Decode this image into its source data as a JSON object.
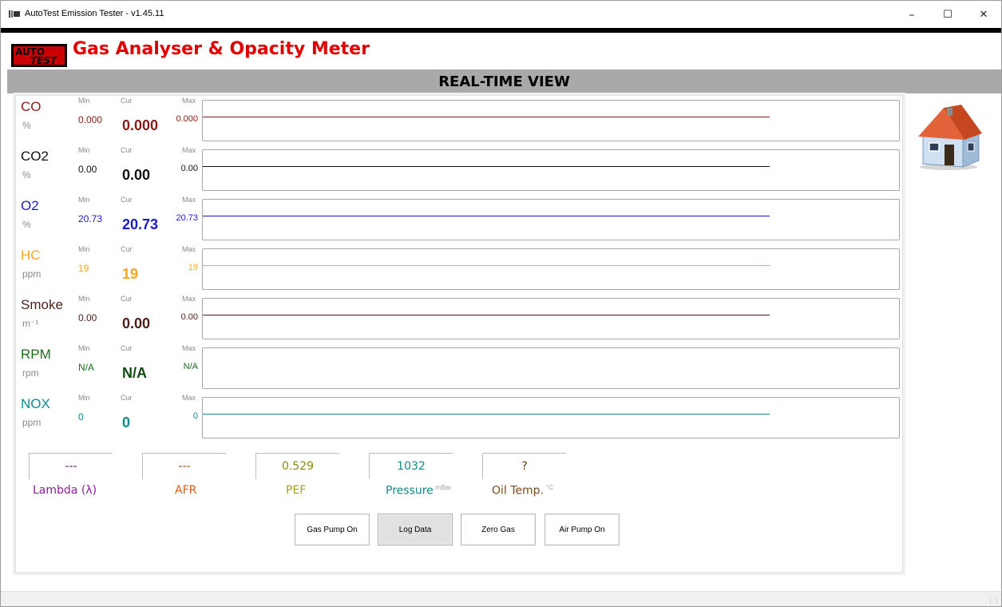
{
  "window": {
    "title": "AutoTest Emission Tester - v1.45.11",
    "minimize_glyph": "–",
    "maximize_glyph": "☐",
    "close_glyph": "✕"
  },
  "header": {
    "logo_top": "AUTO",
    "logo_bottom": "TEST",
    "title": "Gas Analyser & Opacity Meter",
    "title_color": "#e00000"
  },
  "view_title": "REAL-TIME VIEW",
  "home_icon": "house-icon",
  "sensors": [
    {
      "name": "CO",
      "unit": "%",
      "min_label": "Min",
      "cur_label": "Cur",
      "max_label": "Max",
      "min": "0.000",
      "cur": "0.000",
      "max": "0.000",
      "color": "#8b1a1a"
    },
    {
      "name": "CO2",
      "unit": "%",
      "min_label": "Min",
      "cur_label": "Cur",
      "max_label": "Max",
      "min": "0.00",
      "cur": "0.00",
      "max": "0.00",
      "color": "#111111"
    },
    {
      "name": "O2",
      "unit": "%",
      "min_label": "Min",
      "cur_label": "Cur",
      "max_label": "Max",
      "min": "20.73",
      "cur": "20.73",
      "max": "20.73",
      "color": "#1a1ad6"
    },
    {
      "name": "HC",
      "unit": "ppm",
      "min_label": "Min",
      "cur_label": "Cur",
      "max_label": "Max",
      "min": "19",
      "cur": "19",
      "max": "19",
      "color": "#f5a623"
    },
    {
      "name": "Smoke",
      "unit": "m⁻¹",
      "min_label": "Min",
      "cur_label": "Cur",
      "max_label": "Max",
      "min": "0.00",
      "cur": "0.00",
      "max": "0.00",
      "color": "#4a1f1a"
    },
    {
      "name": "RPM",
      "unit": "rpm",
      "min_label": "Min",
      "cur_label": "Cur",
      "max_label": "Max",
      "min": "N/A",
      "cur": "N/A",
      "max": "N/A",
      "color": "#1e6b1e"
    },
    {
      "name": "NOX",
      "unit": "ppm",
      "min_label": "Min",
      "cur_label": "Cur",
      "max_label": "Max",
      "min": "0",
      "cur": "0",
      "max": "0",
      "color": "#108a8a"
    }
  ],
  "readouts": {
    "lambda": {
      "value": "---",
      "label": "Lambda (λ)",
      "value_color": "#5a1a7a",
      "label_color": "#8e1f9e"
    },
    "afr": {
      "value": "---",
      "label": "AFR",
      "value_color": "#9a4a10",
      "label_color": "#d2601a"
    },
    "pef": {
      "value": "0.529",
      "label": "PEF",
      "value_color": "#8a8a10",
      "label_color": "#a0a020"
    },
    "pressure": {
      "value": "1032",
      "label": "Pressure",
      "unit": "mBar",
      "value_color": "#108a8a",
      "label_color": "#108a8a"
    },
    "oil_temp": {
      "value": "?",
      "label": "Oil Temp.",
      "unit": "°C",
      "value_color": "#6a3a10",
      "label_color": "#7a4a1a"
    }
  },
  "buttons": {
    "gas_pump": "Gas Pump On",
    "log_data": "Log Data",
    "zero_gas": "Zero Gas",
    "air_pump": "Air Pump On"
  }
}
